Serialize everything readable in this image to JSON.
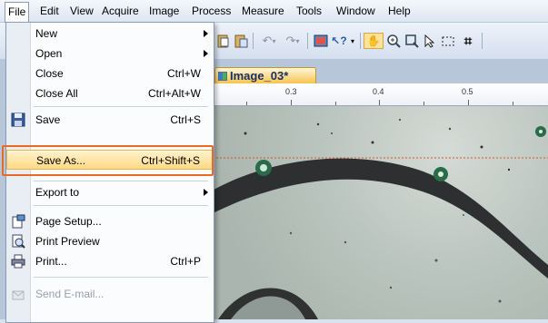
{
  "menubar": {
    "items": [
      "File",
      "Edit",
      "View",
      "Acquire",
      "Image",
      "Process",
      "Measure",
      "Tools",
      "Window",
      "Help"
    ]
  },
  "document": {
    "tab_title": "Image_03*",
    "ruler_labels": [
      "0.3",
      "0.4",
      "0.5"
    ]
  },
  "file_menu": {
    "items": [
      {
        "label": "New",
        "shortcut": "",
        "submenu": true
      },
      {
        "label": "Open",
        "shortcut": "",
        "submenu": true
      },
      {
        "label": "Close",
        "shortcut": "Ctrl+W",
        "submenu": false
      },
      {
        "label": "Close All",
        "shortcut": "Ctrl+Alt+W",
        "submenu": false
      },
      {
        "label": "Save",
        "shortcut": "Ctrl+S",
        "submenu": false,
        "icon": "floppy-disk-icon"
      },
      {
        "label": "Save As...",
        "shortcut": "Ctrl+Shift+S",
        "submenu": false,
        "highlighted": true
      },
      {
        "label": "Export to",
        "shortcut": "",
        "submenu": true
      },
      {
        "label": "Page Setup...",
        "shortcut": "",
        "submenu": false,
        "icon": "page-setup-icon"
      },
      {
        "label": "Print Preview",
        "shortcut": "",
        "submenu": false,
        "icon": "print-preview-icon"
      },
      {
        "label": "Print...",
        "shortcut": "Ctrl+P",
        "submenu": false,
        "icon": "printer-icon"
      },
      {
        "label": "Send E-mail...",
        "shortcut": "",
        "submenu": false,
        "disabled": true,
        "icon": "email-icon"
      }
    ]
  },
  "colors": {
    "accent": "#e96a24",
    "highlight": "#ffd983"
  }
}
